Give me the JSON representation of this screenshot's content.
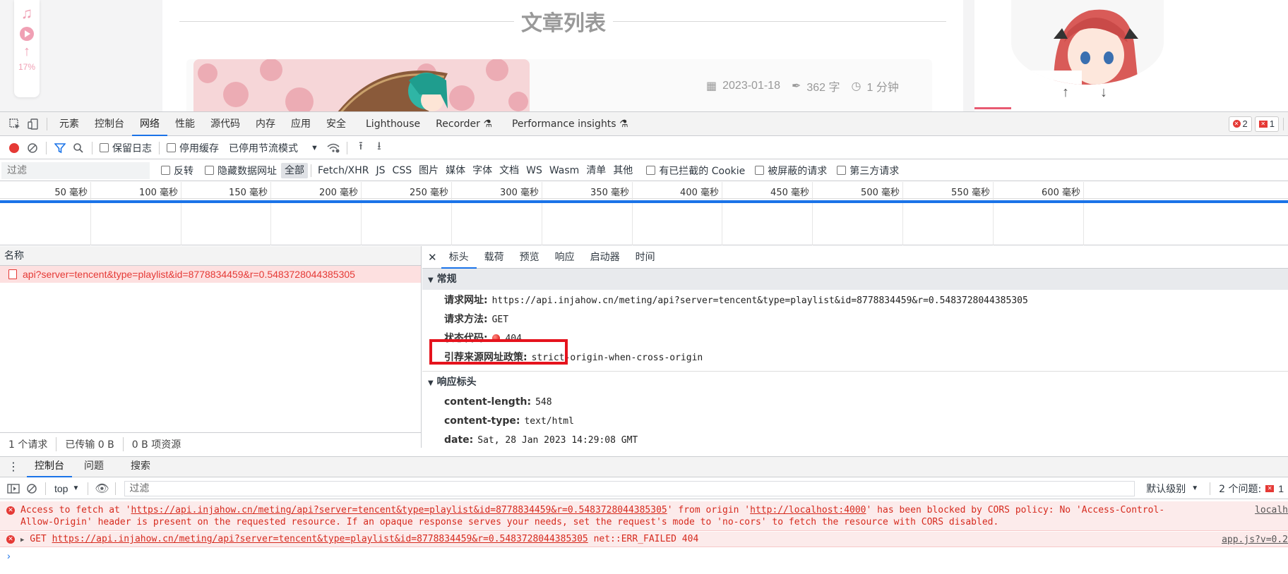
{
  "page": {
    "title": "文章列表",
    "scroll_percent": "17%",
    "post": {
      "date": "2023-01-18",
      "words": "362 字",
      "read_time": "1 分钟"
    }
  },
  "devtools": {
    "main_tabs": [
      "元素",
      "控制台",
      "网络",
      "性能",
      "源代码",
      "内存",
      "应用",
      "安全",
      "Lighthouse",
      "Recorder",
      "Performance insights"
    ],
    "active_tab": "网络",
    "error_count": "2",
    "issue_count": "1",
    "toolbar": {
      "preserve_log": "保留日志",
      "disable_cache": "停用缓存",
      "throttle": "已停用节流模式"
    },
    "filter": {
      "placeholder": "过滤",
      "invert": "反转",
      "hide_data_urls": "隐藏数据网址",
      "types": [
        "全部",
        "Fetch/XHR",
        "JS",
        "CSS",
        "图片",
        "媒体",
        "字体",
        "文档",
        "WS",
        "Wasm",
        "清单",
        "其他"
      ],
      "blocked_cookies": "有已拦截的 Cookie",
      "blocked_requests": "被屏蔽的请求",
      "third_party": "第三方请求"
    },
    "timeline_ticks": [
      "50 毫秒",
      "100 毫秒",
      "150 毫秒",
      "200 毫秒",
      "250 毫秒",
      "300 毫秒",
      "350 毫秒",
      "400 毫秒",
      "450 毫秒",
      "500 毫秒",
      "550 毫秒",
      "600 毫秒"
    ],
    "request_list": {
      "header": "名称",
      "rows": [
        "api?server=tencent&type=playlist&id=8778834459&r=0.5483728044385305"
      ],
      "status": [
        "1 个请求",
        "已传输 0 B",
        "0 B 项资源"
      ]
    },
    "detail": {
      "tabs": [
        "标头",
        "载荷",
        "预览",
        "响应",
        "启动器",
        "时间"
      ],
      "active_tab": "标头",
      "general_title": "常规",
      "general": [
        {
          "k": "请求网址:",
          "v": "https://api.injahow.cn/meting/api?server=tencent&type=playlist&id=8778834459&r=0.5483728044385305"
        },
        {
          "k": "请求方法:",
          "v": "GET"
        },
        {
          "k": "状态代码:",
          "v": "404"
        },
        {
          "k": "引荐来源网址政策:",
          "v": "strict-origin-when-cross-origin"
        }
      ],
      "response_title": "响应标头",
      "response": [
        {
          "k": "content-length:",
          "v": "548"
        },
        {
          "k": "content-type:",
          "v": "text/html"
        },
        {
          "k": "date:",
          "v": "Sat, 28 Jan 2023 14:29:08 GMT"
        }
      ]
    },
    "drawer": {
      "tabs": [
        "控制台",
        "问题",
        "搜索"
      ],
      "context": "top",
      "filter_placeholder": "过滤",
      "level": "默认级别",
      "issues": "2 个问题:",
      "issues_count": "1"
    },
    "console": [
      {
        "text_pre": "Access to fetch at '",
        "url1": "https://api.injahow.cn/meting/api?server=tencent&type=playlist&id=8778834459&r=0.5483728044385305",
        "text_mid": "' from origin '",
        "url2": "http://localhost:4000",
        "text_post": "' has been blocked by CORS policy: No 'Access-Control-",
        "line2": "Allow-Origin' header is present on the requested resource. If an opaque response serves your needs, set the request's mode to 'no-cors' to fetch the resource with CORS disabled.",
        "source": "localh"
      },
      {
        "method": "GET",
        "url": "https://api.injahow.cn/meting/api?server=tencent&type=playlist&id=8778834459&r=0.5483728044385305",
        "suffix": "net::ERR_FAILED 404",
        "source": "app.js?v=0.2"
      }
    ]
  }
}
